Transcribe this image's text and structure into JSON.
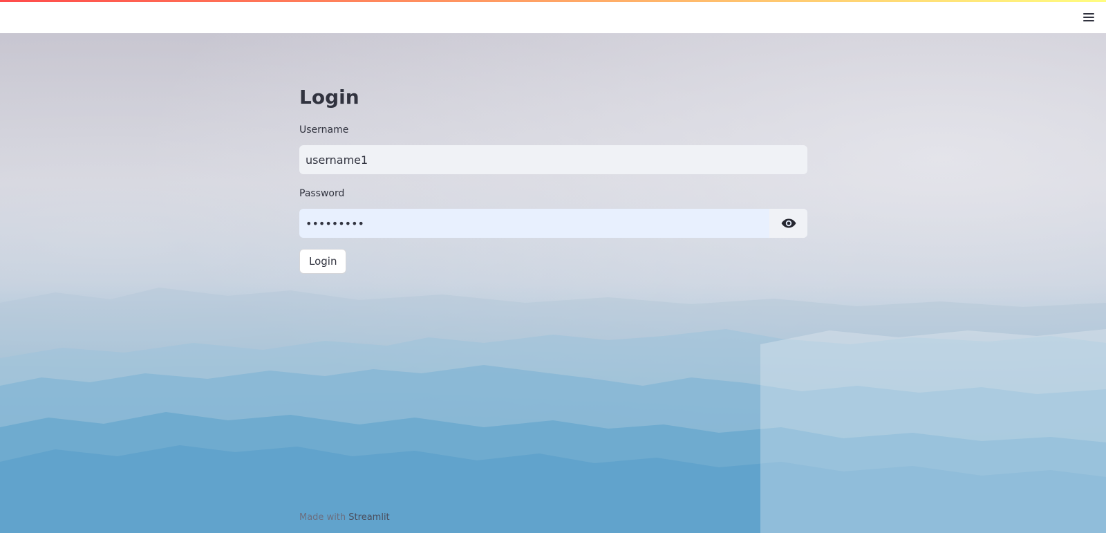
{
  "header": {
    "menu_icon": "hamburger-menu-icon"
  },
  "login": {
    "title": "Login",
    "username_label": "Username",
    "username_value": "username1",
    "password_label": "Password",
    "password_value": "•••••••••",
    "toggle_icon": "eye-icon",
    "submit_label": "Login"
  },
  "footer": {
    "prefix": "Made with",
    "brand": "Streamlit"
  },
  "colors": {
    "accent_gradient_start": "#ff4b4b",
    "accent_gradient_end": "#fffd80",
    "text": "#31333f",
    "input_bg": "#f0f2f6",
    "autofill_bg": "#e8f0fe"
  }
}
